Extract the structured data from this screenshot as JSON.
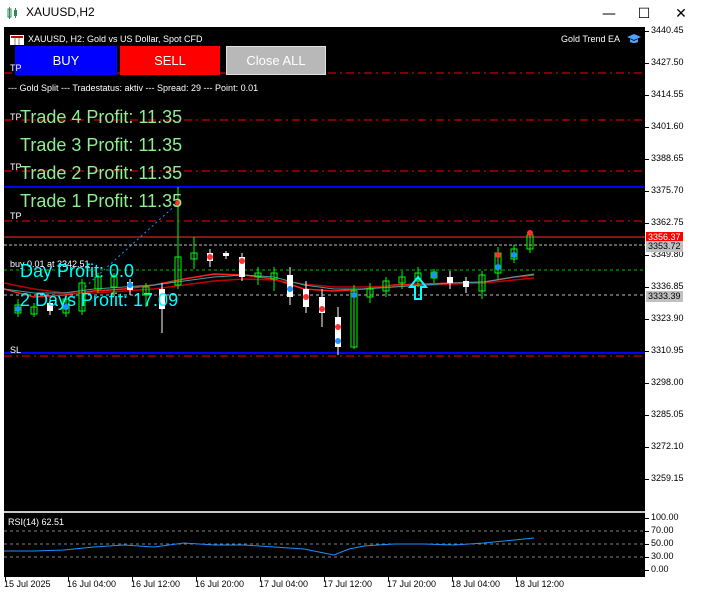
{
  "window": {
    "title": "XAUUSD,H2",
    "minimize_label": "—",
    "maximize_label": "☐",
    "close_label": "✕"
  },
  "chart": {
    "symbol_info": "XAUUSD, H2:  Gold vs US Dollar, Spot CFD",
    "ea_name": "Gold Trend EA",
    "ea_icon": "graduation-cap-icon",
    "status_line": "--- Gold Split --- Tradestatus: aktiv --- Spread: 29 --- Point: 0.01",
    "buy_label": "BUY",
    "sell_label": "SELL",
    "closeall_label": "Close ALL",
    "trades": [
      {
        "label": "Trade 4 Profit: 11.35",
        "tp": "TP"
      },
      {
        "label": "Trade 3 Profit: 11.35",
        "tp": "TP"
      },
      {
        "label": "Trade 2 Profit: 11.35",
        "tp": "TP"
      },
      {
        "label": "Trade 1 Profit: 11.35",
        "tp": "TP"
      }
    ],
    "tp_top": "TP",
    "sl_label": "SL",
    "position_label": "buy 0.01 at 3342.51",
    "day_profit": "Day Profit: 0.0",
    "two_days_profit": "2 Days Profit: 17.09",
    "colors": {
      "trade_text": "#90ee90",
      "profit_text": "#00ffff",
      "bull_candle": "#00ff00",
      "bear_candle": "#ffffff",
      "ma_red": "#ff2020",
      "ma_darkred": "#c00000",
      "tp_line": "#ff0000",
      "hline_blue": "#0000ff",
      "rsi_line": "#1e90ff"
    }
  },
  "price_axis": {
    "labels": [
      "3440.45",
      "3427.50",
      "3414.55",
      "3401.60",
      "3388.65",
      "3375.70",
      "3362.75",
      "3349.80",
      "3336.85",
      "3323.90",
      "3310.95",
      "3298.00",
      "3285.05",
      "3272.10",
      "3259.15"
    ],
    "current_bid": "3356.37",
    "current_ask": "3353.72",
    "position_price": "3333.39"
  },
  "rsi": {
    "label": "RSI(14) 62.51",
    "levels": [
      "100.00",
      "70.00",
      "50.00",
      "30.00",
      "0.00"
    ]
  },
  "time_axis": {
    "labels": [
      "15 Jul 2025",
      "16 Jul 04:00",
      "16 Jul 12:00",
      "16 Jul 20:00",
      "17 Jul 04:00",
      "17 Jul 12:00",
      "17 Jul 20:00",
      "18 Jul 04:00",
      "18 Jul 12:00"
    ]
  }
}
